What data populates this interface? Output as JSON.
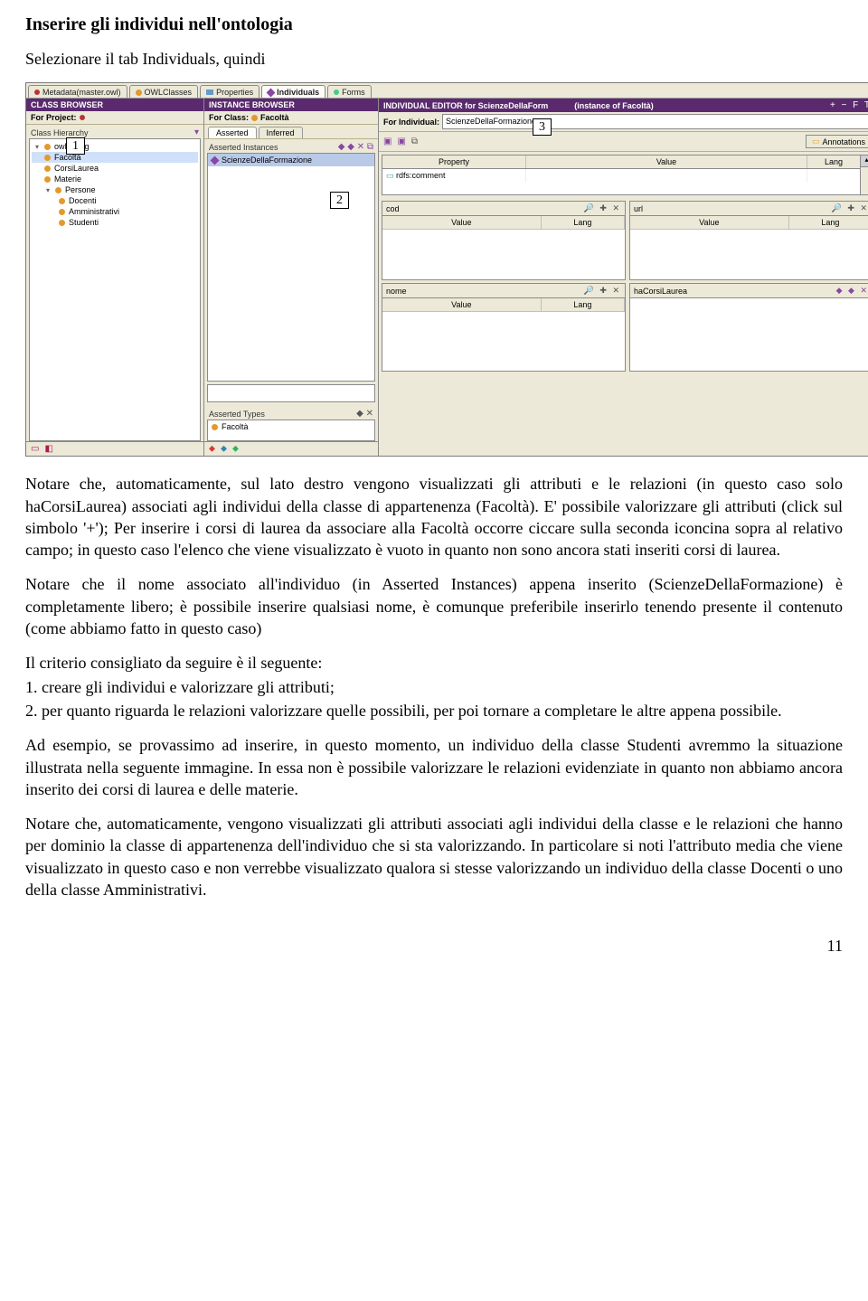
{
  "doc": {
    "title": "Inserire gli individui nell'ontologia",
    "intro": "Selezionare il tab Individuals, quindi",
    "para1": "Notare che, automaticamente, sul lato destro vengono visualizzati gli attributi e le relazioni (in questo caso solo haCorsiLaurea) associati agli individui della classe di appartenenza (Facoltà). E' possibile valorizzare gli attributi (click sul simbolo '+'); Per inserire i corsi di laurea da associare alla Facoltà occorre ciccare sulla seconda iconcina sopra al relativo campo; in questo caso l'elenco che viene visualizzato è vuoto in quanto non sono ancora stati inseriti corsi di laurea.",
    "para2": "Notare che il nome associato all'individuo (in Asserted Instances) appena inserito (ScienzeDellaFormazione) è completamente libero; è possibile inserire qualsiasi nome, è comunque preferibile inserirlo tenendo presente il contenuto (come abbiamo fatto in questo caso)",
    "criteria_intro": "Il criterio consigliato da seguire è il seguente:",
    "li1": "creare gli individui e valorizzare gli attributi;",
    "li2": "per quanto riguarda le relazioni valorizzare quelle possibili, per poi tornare a completare le altre appena possibile.",
    "para3": "Ad esempio, se provassimo ad inserire, in questo momento, un individuo della classe Studenti avremmo la situazione illustrata nella seguente immagine. In essa non è possibile valorizzare le relazioni evidenziate in quanto non abbiamo ancora inserito dei corsi di laurea e delle materie.",
    "para4": "Notare che, automaticamente, vengono visualizzati gli attributi associati agli individui della classe e le relazioni che hanno per dominio la classe di appartenenza dell'individuo che si sta valorizzando. In particolare si noti l'attributo media che viene visualizzato in questo caso e non verrebbe visualizzato qualora si stesse valorizzando  un individuo della classe Docenti o uno della classe Amministrativi.",
    "page_number": "11"
  },
  "callouts": {
    "c1": "1",
    "c2": "2",
    "c3": "3"
  },
  "app": {
    "tabs": {
      "metadata": "Metadata(master.owl)",
      "owl_classes": "OWLClasses",
      "properties": "Properties",
      "individuals": "Individuals",
      "forms": "Forms"
    },
    "class_browser": {
      "title": "CLASS BROWSER",
      "for_project": "For Project:",
      "hierarchy_label": "Class Hierarchy",
      "tree": {
        "root": "owl:Thing",
        "n1": "Facoltà",
        "n2": "CorsiLaurea",
        "n3": "Materie",
        "n4": "Persone",
        "n4a": "Docenti",
        "n4b": "Amministrativi",
        "n4c": "Studenti"
      }
    },
    "instance_browser": {
      "title": "INSTANCE BROWSER",
      "for_class": "For Class:",
      "class_value": "Facoltà",
      "inner_tabs": {
        "asserted": "Asserted",
        "inferred": "Inferred"
      },
      "asserted_instances_label": "Asserted Instances",
      "instance1": "ScienzeDellaFormazione",
      "asserted_types_label": "Asserted Types",
      "type1": "Facoltà"
    },
    "editor": {
      "title_prefix": "INDIVIDUAL EDITOR for ScienzeDellaForm",
      "title_suffix": "(instance of Facoltà)",
      "for_individual": "For Individual:",
      "individual_value": "ScienzeDellaFormazione",
      "annotations_btn": "Annotations",
      "table": {
        "property": "Property",
        "value": "Value",
        "lang": "Lang",
        "prop1": "rdfs:comment"
      },
      "slots": {
        "cod": "cod",
        "url": "url",
        "nome": "nome",
        "haCorsiLaurea": "haCorsiLaurea",
        "value": "Value",
        "lang": "Lang"
      }
    }
  }
}
